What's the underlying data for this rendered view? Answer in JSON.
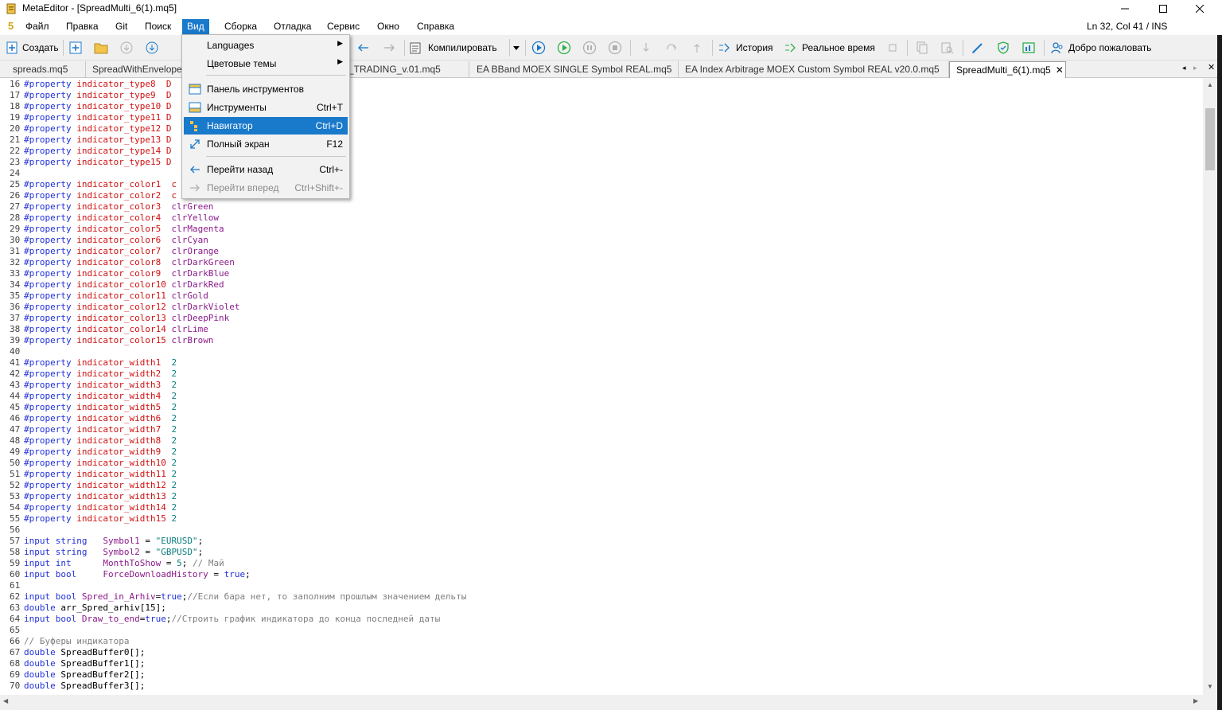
{
  "window": {
    "title": "MetaEditor - [SpreadMulti_6(1).mq5]"
  },
  "menubar": {
    "logo": "5",
    "items": [
      "Файл",
      "Правка",
      "Git",
      "Поиск",
      "Вид",
      "Сборка",
      "Отладка",
      "Сервис",
      "Окно",
      "Справка"
    ],
    "status": "Ln 32, Col 41 / INS"
  },
  "toolbar": {
    "create": "Создать",
    "compile": "Компилировать",
    "history": "История",
    "realtime": "Реальное время",
    "welcome": "Добро пожаловать"
  },
  "tabs": [
    "spreads.mq5",
    "SpreadWithEnvelope",
    "GRID_TRADING_v.01.mq5",
    "EA BBand MOEX SINGLE Symbol REAL.mq5",
    "EA Index Arbitrage MOEX Custom Symbol REAL v20.0.mq5",
    "SpreadMulti_6(1).mq5"
  ],
  "dropdown": {
    "items": [
      {
        "label": "Languages",
        "shortcut": "",
        "submenu": true
      },
      {
        "label": "Цветовые темы",
        "shortcut": "",
        "submenu": true
      },
      {
        "label": "Панель инструментов",
        "shortcut": ""
      },
      {
        "label": "Инструменты",
        "shortcut": "Ctrl+T"
      },
      {
        "label": "Навигатор",
        "shortcut": "Ctrl+D"
      },
      {
        "label": "Полный экран",
        "shortcut": "F12"
      },
      {
        "label": "Перейти назад",
        "shortcut": "Ctrl+-"
      },
      {
        "label": "Перейти вперед",
        "shortcut": "Ctrl+Shift+-"
      }
    ]
  },
  "code": [
    {
      "n": "16",
      "t": [
        [
          "kw",
          "#property "
        ],
        [
          "pr",
          "indicator_type8  "
        ],
        [
          "pr",
          "D"
        ]
      ]
    },
    {
      "n": "17",
      "t": [
        [
          "kw",
          "#property "
        ],
        [
          "pr",
          "indicator_type9  "
        ],
        [
          "pr",
          "D"
        ]
      ]
    },
    {
      "n": "18",
      "t": [
        [
          "kw",
          "#property "
        ],
        [
          "pr",
          "indicator_type10 "
        ],
        [
          "pr",
          "D"
        ]
      ]
    },
    {
      "n": "19",
      "t": [
        [
          "kw",
          "#property "
        ],
        [
          "pr",
          "indicator_type11 "
        ],
        [
          "pr",
          "D"
        ]
      ]
    },
    {
      "n": "20",
      "t": [
        [
          "kw",
          "#property "
        ],
        [
          "pr",
          "indicator_type12 "
        ],
        [
          "pr",
          "D"
        ]
      ]
    },
    {
      "n": "21",
      "t": [
        [
          "kw",
          "#property "
        ],
        [
          "pr",
          "indicator_type13 "
        ],
        [
          "pr",
          "D"
        ]
      ]
    },
    {
      "n": "22",
      "t": [
        [
          "kw",
          "#property "
        ],
        [
          "pr",
          "indicator_type14 "
        ],
        [
          "pr",
          "D"
        ]
      ]
    },
    {
      "n": "23",
      "t": [
        [
          "kw",
          "#property "
        ],
        [
          "pr",
          "indicator_type15 "
        ],
        [
          "pr",
          "D"
        ]
      ]
    },
    {
      "n": "24",
      "t": []
    },
    {
      "n": "25",
      "t": [
        [
          "kw",
          "#property "
        ],
        [
          "pr",
          "indicator_color1  "
        ],
        [
          "pr",
          "c"
        ]
      ]
    },
    {
      "n": "26",
      "t": [
        [
          "kw",
          "#property "
        ],
        [
          "pr",
          "indicator_color2  "
        ],
        [
          "pr",
          "c"
        ]
      ]
    },
    {
      "n": "27",
      "t": [
        [
          "kw",
          "#property "
        ],
        [
          "pr",
          "indicator_color3  "
        ],
        [
          "id",
          "clrGreen"
        ]
      ]
    },
    {
      "n": "28",
      "t": [
        [
          "kw",
          "#property "
        ],
        [
          "pr",
          "indicator_color4  "
        ],
        [
          "id",
          "clrYellow"
        ]
      ]
    },
    {
      "n": "29",
      "t": [
        [
          "kw",
          "#property "
        ],
        [
          "pr",
          "indicator_color5  "
        ],
        [
          "id",
          "clrMagenta"
        ]
      ]
    },
    {
      "n": "30",
      "t": [
        [
          "kw",
          "#property "
        ],
        [
          "pr",
          "indicator_color6  "
        ],
        [
          "id",
          "clrCyan"
        ]
      ]
    },
    {
      "n": "31",
      "t": [
        [
          "kw",
          "#property "
        ],
        [
          "pr",
          "indicator_color7  "
        ],
        [
          "id",
          "clrOrange"
        ]
      ]
    },
    {
      "n": "32",
      "t": [
        [
          "kw",
          "#property "
        ],
        [
          "pr",
          "indicator_color8  "
        ],
        [
          "id",
          "clrDarkGreen"
        ]
      ]
    },
    {
      "n": "33",
      "t": [
        [
          "kw",
          "#property "
        ],
        [
          "pr",
          "indicator_color9  "
        ],
        [
          "id",
          "clrDarkBlue"
        ]
      ]
    },
    {
      "n": "34",
      "t": [
        [
          "kw",
          "#property "
        ],
        [
          "pr",
          "indicator_color10 "
        ],
        [
          "id",
          "clrDarkRed"
        ]
      ]
    },
    {
      "n": "35",
      "t": [
        [
          "kw",
          "#property "
        ],
        [
          "pr",
          "indicator_color11 "
        ],
        [
          "id",
          "clrGold"
        ]
      ]
    },
    {
      "n": "36",
      "t": [
        [
          "kw",
          "#property "
        ],
        [
          "pr",
          "indicator_color12 "
        ],
        [
          "id",
          "clrDarkViolet"
        ]
      ]
    },
    {
      "n": "37",
      "t": [
        [
          "kw",
          "#property "
        ],
        [
          "pr",
          "indicator_color13 "
        ],
        [
          "id",
          "clrDeepPink"
        ]
      ]
    },
    {
      "n": "38",
      "t": [
        [
          "kw",
          "#property "
        ],
        [
          "pr",
          "indicator_color14 "
        ],
        [
          "id",
          "clrLime"
        ]
      ]
    },
    {
      "n": "39",
      "t": [
        [
          "kw",
          "#property "
        ],
        [
          "pr",
          "indicator_color15 "
        ],
        [
          "id",
          "clrBrown"
        ]
      ]
    },
    {
      "n": "40",
      "t": []
    },
    {
      "n": "41",
      "t": [
        [
          "kw",
          "#property "
        ],
        [
          "pr",
          "indicator_width1  "
        ],
        [
          "st",
          "2"
        ]
      ]
    },
    {
      "n": "42",
      "t": [
        [
          "kw",
          "#property "
        ],
        [
          "pr",
          "indicator_width2  "
        ],
        [
          "st",
          "2"
        ]
      ]
    },
    {
      "n": "43",
      "t": [
        [
          "kw",
          "#property "
        ],
        [
          "pr",
          "indicator_width3  "
        ],
        [
          "st",
          "2"
        ]
      ]
    },
    {
      "n": "44",
      "t": [
        [
          "kw",
          "#property "
        ],
        [
          "pr",
          "indicator_width4  "
        ],
        [
          "st",
          "2"
        ]
      ]
    },
    {
      "n": "45",
      "t": [
        [
          "kw",
          "#property "
        ],
        [
          "pr",
          "indicator_width5  "
        ],
        [
          "st",
          "2"
        ]
      ]
    },
    {
      "n": "46",
      "t": [
        [
          "kw",
          "#property "
        ],
        [
          "pr",
          "indicator_width6  "
        ],
        [
          "st",
          "2"
        ]
      ]
    },
    {
      "n": "47",
      "t": [
        [
          "kw",
          "#property "
        ],
        [
          "pr",
          "indicator_width7  "
        ],
        [
          "st",
          "2"
        ]
      ]
    },
    {
      "n": "48",
      "t": [
        [
          "kw",
          "#property "
        ],
        [
          "pr",
          "indicator_width8  "
        ],
        [
          "st",
          "2"
        ]
      ]
    },
    {
      "n": "49",
      "t": [
        [
          "kw",
          "#property "
        ],
        [
          "pr",
          "indicator_width9  "
        ],
        [
          "st",
          "2"
        ]
      ]
    },
    {
      "n": "50",
      "t": [
        [
          "kw",
          "#property "
        ],
        [
          "pr",
          "indicator_width10 "
        ],
        [
          "st",
          "2"
        ]
      ]
    },
    {
      "n": "51",
      "t": [
        [
          "kw",
          "#property "
        ],
        [
          "pr",
          "indicator_width11 "
        ],
        [
          "st",
          "2"
        ]
      ]
    },
    {
      "n": "52",
      "t": [
        [
          "kw",
          "#property "
        ],
        [
          "pr",
          "indicator_width12 "
        ],
        [
          "st",
          "2"
        ]
      ]
    },
    {
      "n": "53",
      "t": [
        [
          "kw",
          "#property "
        ],
        [
          "pr",
          "indicator_width13 "
        ],
        [
          "st",
          "2"
        ]
      ]
    },
    {
      "n": "54",
      "t": [
        [
          "kw",
          "#property "
        ],
        [
          "pr",
          "indicator_width14 "
        ],
        [
          "st",
          "2"
        ]
      ]
    },
    {
      "n": "55",
      "t": [
        [
          "kw",
          "#property "
        ],
        [
          "pr",
          "indicator_width15 "
        ],
        [
          "st",
          "2"
        ]
      ]
    },
    {
      "n": "56",
      "t": []
    },
    {
      "n": "57",
      "t": [
        [
          "kw",
          "input string   "
        ],
        [
          "id",
          "Symbol1"
        ],
        [
          "nm",
          " = "
        ],
        [
          "st",
          "\"EURUSD\""
        ],
        [
          "nm",
          ";"
        ]
      ]
    },
    {
      "n": "58",
      "t": [
        [
          "kw",
          "input string   "
        ],
        [
          "id",
          "Symbol2"
        ],
        [
          "nm",
          " = "
        ],
        [
          "st",
          "\"GBPUSD\""
        ],
        [
          "nm",
          ";"
        ]
      ]
    },
    {
      "n": "59",
      "t": [
        [
          "kw",
          "input int      "
        ],
        [
          "id",
          "MonthToShow"
        ],
        [
          "nm",
          " = "
        ],
        [
          "st",
          "5"
        ],
        [
          "nm",
          "; "
        ],
        [
          "cm",
          "// Май"
        ]
      ]
    },
    {
      "n": "60",
      "t": [
        [
          "kw",
          "input bool     "
        ],
        [
          "id",
          "ForceDownloadHistory"
        ],
        [
          "nm",
          " = "
        ],
        [
          "kw",
          "true"
        ],
        [
          "nm",
          ";"
        ]
      ]
    },
    {
      "n": "61",
      "t": []
    },
    {
      "n": "62",
      "t": [
        [
          "kw",
          "input bool "
        ],
        [
          "id",
          "Spred_in_Arhiv"
        ],
        [
          "nm",
          "="
        ],
        [
          "kw",
          "true"
        ],
        [
          "nm",
          ";"
        ],
        [
          "cm",
          "//Если бара нет, то заполним прошлым значением дельты"
        ]
      ]
    },
    {
      "n": "63",
      "t": [
        [
          "kw",
          "double "
        ],
        [
          "nm",
          "arr_Spred_arhiv[15];"
        ]
      ]
    },
    {
      "n": "64",
      "t": [
        [
          "kw",
          "input bool "
        ],
        [
          "id",
          "Draw_to_end"
        ],
        [
          "nm",
          "="
        ],
        [
          "kw",
          "true"
        ],
        [
          "nm",
          ";"
        ],
        [
          "cm",
          "//Строить график индикатора до конца последней даты"
        ]
      ]
    },
    {
      "n": "65",
      "t": []
    },
    {
      "n": "66",
      "t": [
        [
          "cm",
          "// Буферы индикатора"
        ]
      ]
    },
    {
      "n": "67",
      "t": [
        [
          "kw",
          "double "
        ],
        [
          "nm",
          "SpreadBuffer0[];"
        ]
      ]
    },
    {
      "n": "68",
      "t": [
        [
          "kw",
          "double "
        ],
        [
          "nm",
          "SpreadBuffer1[];"
        ]
      ]
    },
    {
      "n": "69",
      "t": [
        [
          "kw",
          "double "
        ],
        [
          "nm",
          "SpreadBuffer2[];"
        ]
      ]
    },
    {
      "n": "70",
      "t": [
        [
          "kw",
          "double "
        ],
        [
          "nm",
          "SpreadBuffer3[];"
        ]
      ]
    }
  ]
}
